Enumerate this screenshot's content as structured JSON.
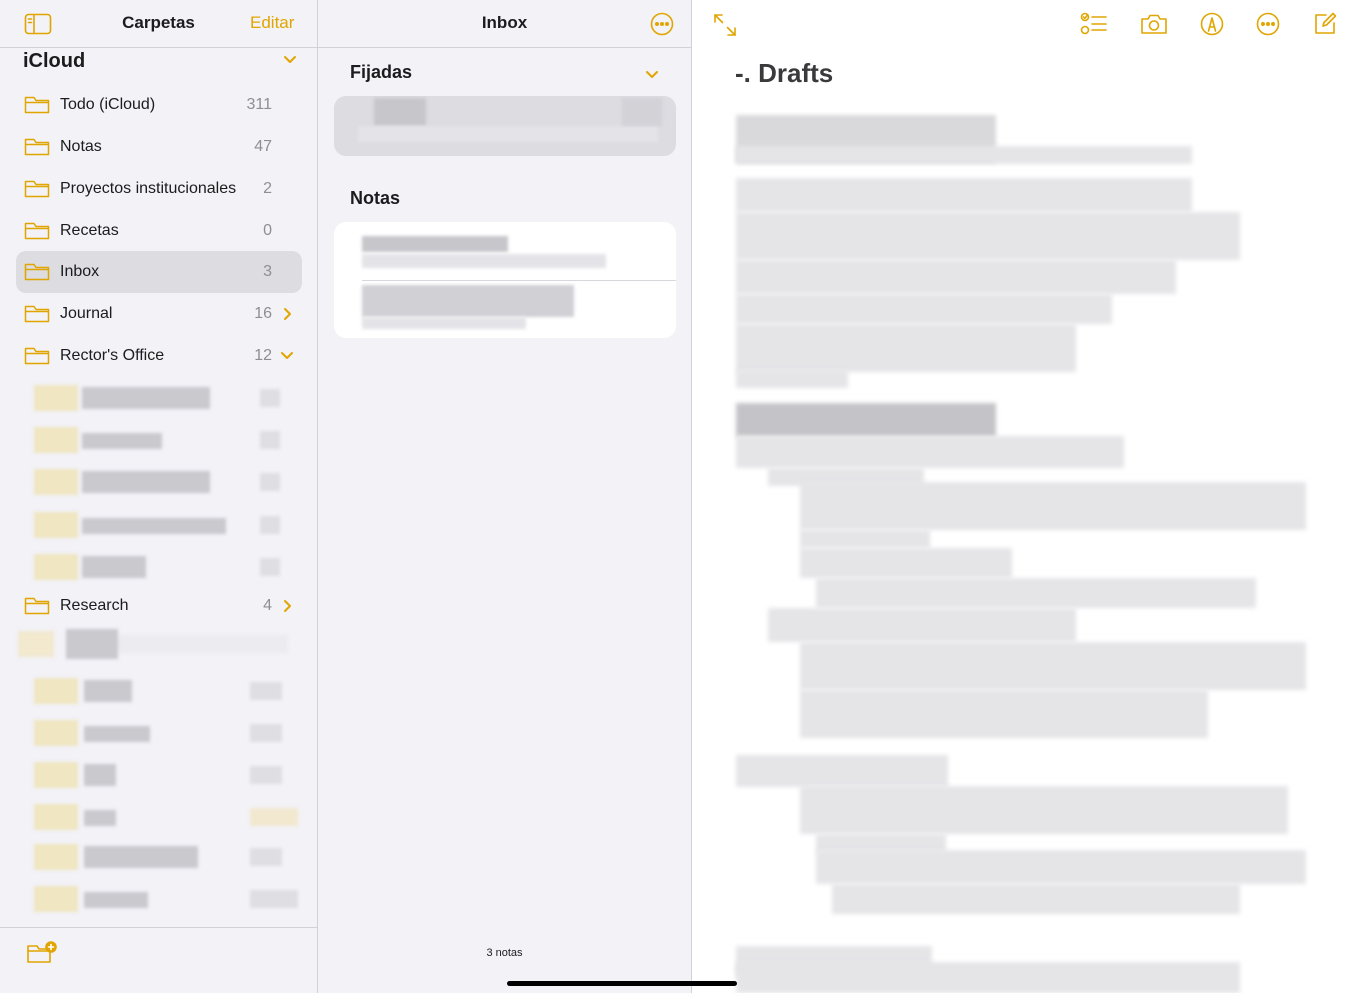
{
  "colors": {
    "accent": "#e1a500",
    "sidebar_bg": "#f2f2f7",
    "selected_row": "#dcdce1"
  },
  "sidebar": {
    "toggle_icon": "sidebar-toggle-icon",
    "title": "Carpetas",
    "edit_label": "Editar",
    "account": "iCloud",
    "folders": [
      {
        "name": "Todo (iCloud)",
        "count": "311"
      },
      {
        "name": "Notas",
        "count": "47"
      },
      {
        "name": "Proyectos institucionales",
        "count": "2"
      },
      {
        "name": "Recetas",
        "count": "0"
      },
      {
        "name": "Inbox",
        "count": "3",
        "selected": true
      },
      {
        "name": "Journal",
        "count": "16"
      },
      {
        "name": "Rector's Office",
        "count": "12"
      },
      {
        "name": "Research",
        "count": "4"
      }
    ],
    "new_folder_icon": "new-folder-icon"
  },
  "list": {
    "title": "Inbox",
    "more_icon": "more-circle-icon",
    "pinned_label": "Fijadas",
    "notes_label": "Notas",
    "footer": "3 notas"
  },
  "editor": {
    "expand_icon": "expand-arrows-icon",
    "toolbar_icons": [
      "checklist-icon",
      "camera-icon",
      "markup-pen-icon",
      "more-circle-icon",
      "compose-icon"
    ],
    "note_title": "-. Drafts"
  }
}
